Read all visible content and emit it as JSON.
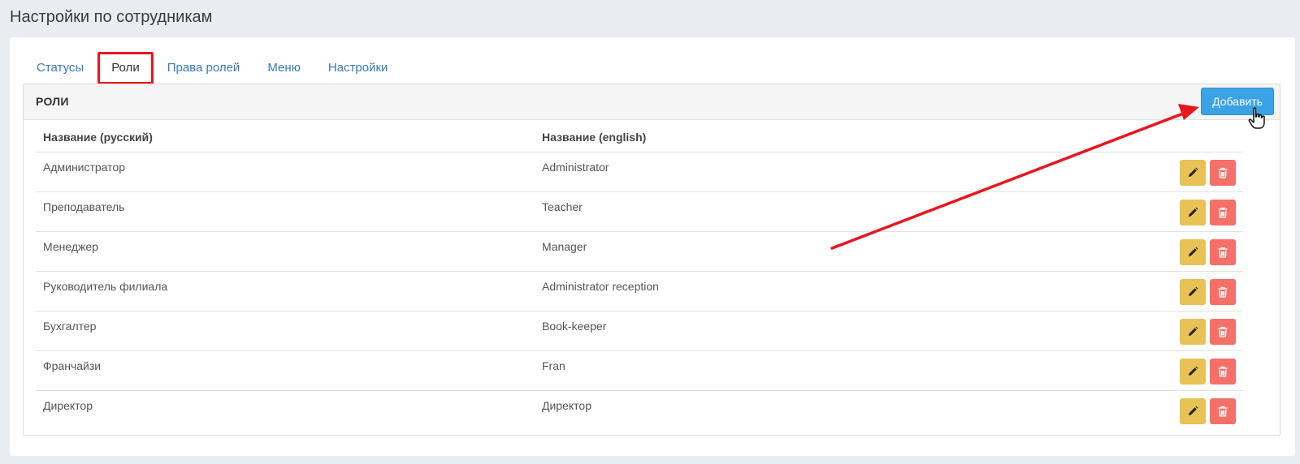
{
  "page": {
    "title": "Настройки по сотрудникам"
  },
  "tabs": [
    {
      "label": "Статусы",
      "active": false
    },
    {
      "label": "Роли",
      "active": true
    },
    {
      "label": "Права ролей",
      "active": false
    },
    {
      "label": "Меню",
      "active": false
    },
    {
      "label": "Настройки",
      "active": false
    }
  ],
  "panel": {
    "title": "РОЛИ",
    "add_label": "Добавить"
  },
  "table": {
    "headers": [
      "Название (русский)",
      "Название (english)"
    ],
    "rows": [
      {
        "ru": "Администратор",
        "en": "Administrator"
      },
      {
        "ru": "Преподаватель",
        "en": "Teacher"
      },
      {
        "ru": "Менеджер",
        "en": "Manager"
      },
      {
        "ru": "Руководитель филиала",
        "en": "Administrator reception"
      },
      {
        "ru": "Бухгалтер",
        "en": "Book-keeper"
      },
      {
        "ru": "Франчайзи",
        "en": "Fran"
      },
      {
        "ru": "Директор",
        "en": "Директор"
      }
    ]
  },
  "colors": {
    "add_button": "#3ba2e6",
    "edit_button": "#e8c255",
    "delete_button": "#f47068",
    "highlight": "#e8161c",
    "link": "#3a7bb5"
  },
  "icons": {
    "edit": "pencil-icon",
    "delete": "trash-icon",
    "cursor": "hand-pointer-icon"
  }
}
